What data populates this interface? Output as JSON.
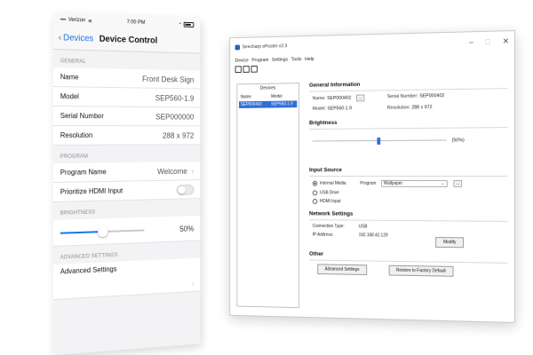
{
  "phone": {
    "status": {
      "carrier": "Verizon",
      "time": "7:00 PM",
      "battery_icon": "battery-icon"
    },
    "nav": {
      "back_label": "Devices",
      "title": "Device Control"
    },
    "general": {
      "section_label": "GENERAL",
      "rows": [
        {
          "label": "Name",
          "value": "Front Desk Sign"
        },
        {
          "label": "Model",
          "value": "SEP560-1.9"
        },
        {
          "label": "Serial Number",
          "value": "SEP000000"
        },
        {
          "label": "Resolution",
          "value": "288 x 972"
        }
      ]
    },
    "program": {
      "section_label": "PROGRAM",
      "name_label": "Program Name",
      "name_value": "Welcome",
      "hdmi_label": "Prioritize HDMI Input",
      "hdmi_on": false
    },
    "brightness": {
      "section_label": "BRIGHTNESS",
      "value_text": "50%",
      "level": 0.5
    },
    "advanced": {
      "section_label": "ADVANCED SETTINGS",
      "row_label": "Advanced Settings"
    }
  },
  "window": {
    "title": "Seecharp ePoster v2.3",
    "controls": {
      "minimize": "–",
      "maximize": "□",
      "close": "✕"
    },
    "menu": [
      "Device",
      "Program",
      "Settings",
      "Tools",
      "Help"
    ],
    "devices": {
      "title": "Devices",
      "columns": [
        "Name",
        "Model"
      ],
      "rows": [
        {
          "name": "SEP000402",
          "model": "SEP560-1.9"
        }
      ]
    },
    "general": {
      "title": "General Information",
      "name_label": "Name:",
      "name_value": "SEP000402",
      "model_label": "Model:",
      "model_value": "SEP560-1.9",
      "serial_label": "Serial Number:",
      "serial_value": "SEP000402",
      "res_label": "Resolution:",
      "res_value": "288 x 972",
      "dots": "..."
    },
    "brightness": {
      "title": "Brightness",
      "value_text": "(50%)",
      "level": 0.5
    },
    "input": {
      "title": "Input Source",
      "options": [
        "Internal Media",
        "USB Drive",
        "HDMI Input"
      ],
      "selected": 0,
      "program_label": "Program",
      "program_value": "Wallpaper",
      "dots": "..."
    },
    "network": {
      "title": "Network Settings",
      "conn_label": "Connection Type:",
      "conn_value": "USB",
      "ip_label": "IP Address:",
      "ip_value": "192.168.42.129",
      "modify": "Modify"
    },
    "other": {
      "title": "Other",
      "advanced": "Advanced Settings",
      "restore": "Restore to Factory Default"
    }
  }
}
